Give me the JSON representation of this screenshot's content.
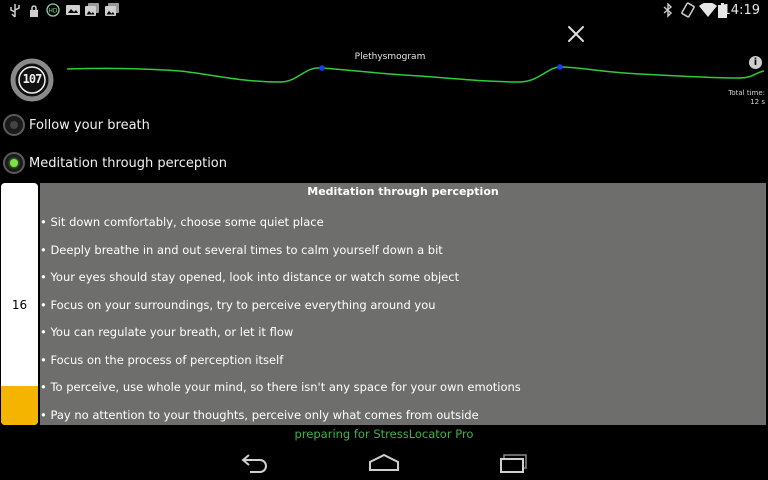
{
  "status_bar": {
    "time": "14:19",
    "left_icons": [
      "usb-icon",
      "lock-icon",
      "hd-icon",
      "photo-icon",
      "gallery-icon"
    ],
    "right_icons": [
      "bluetooth-icon",
      "rotate-icon",
      "wifi-icon",
      "battery-icon"
    ]
  },
  "heart_rate_gauge": {
    "value": "107"
  },
  "plethysmogram": {
    "title": "Plethysmogram",
    "total_time_label": "Total time:",
    "total_time_value": "12 s",
    "line_color": "#2fcc3a",
    "marker_color": "#1b3cff"
  },
  "modes": [
    {
      "label": "Follow your breath",
      "selected": false
    },
    {
      "label": "Meditation through perception",
      "selected": true
    }
  ],
  "level_bar": {
    "value": "16",
    "fill_fraction": 0.16,
    "fill_color": "#f5b400"
  },
  "instructions": {
    "title": "Meditation through perception",
    "steps": [
      "• Sit down comfortably, choose some quiet place",
      "• Deeply breathe in and out several times to calm yourself down a bit",
      "• Your eyes should stay opened, look into distance or watch some object",
      "• Focus on your surroundings, try to perceive everything around you",
      "• You can regulate your breath, or let it flow",
      "• Focus on the process of perception itself",
      "• To perceive, use whole your mind, so there isn't any space for your own emotions",
      "• Pay no attention to your thoughts, perceive only what comes from outside"
    ]
  },
  "footer": {
    "text": "preparing for StressLocator Pro"
  },
  "nav": {
    "buttons": [
      "back-icon",
      "home-icon",
      "recent-apps-icon"
    ]
  }
}
